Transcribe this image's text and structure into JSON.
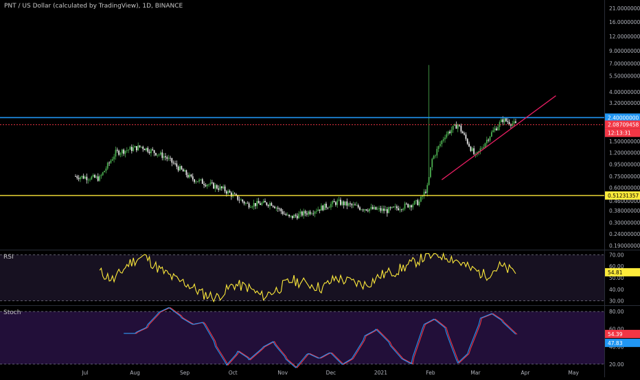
{
  "header": {
    "title": "PNT / US Dollar (calculated by TradingView), 1D, BINANCE"
  },
  "colors": {
    "background": "#000000",
    "up": "#4caf50",
    "down": "#e8e8e8",
    "upper_line": "#2196f3",
    "support_line": "#ffeb3b",
    "last_price_line": "#f23645",
    "trendline": "#e91e63",
    "rsi_line": "#ffeb3b",
    "rsi_band": "#2a1f3d",
    "stoch_k": "#2196f3",
    "stoch_d": "#f23645",
    "stoch_band": "#2b1347",
    "axis_text": "#b2b5be"
  },
  "price_pane": {
    "scale": "log",
    "axis_ticks": [
      "21.00000000",
      "16.00000000",
      "12.00000000",
      "9.00000000",
      "7.00000000",
      "5.50000000",
      "4.00000000",
      "3.20000000",
      "2.40000000",
      "1.50000000",
      "1.20000000",
      "0.95000000",
      "0.75000000",
      "0.60000000",
      "0.46000000",
      "0.38000000",
      "0.30000000",
      "0.24000000",
      "0.19000000"
    ],
    "axis_tick_values": [
      21,
      16,
      12,
      9,
      7,
      5.5,
      4,
      3.2,
      2.4,
      1.5,
      1.2,
      0.95,
      0.75,
      0.6,
      0.46,
      0.38,
      0.3,
      0.24,
      0.19
    ],
    "ylim": [
      0.18,
      24
    ],
    "upper_level": 2.4,
    "upper_label": "2.40000000",
    "support_level": 0.51231357,
    "support_label": "0.51231357",
    "last_price": 2.08709458,
    "last_price_label": "2.08709458",
    "countdown_label": "12:13:31"
  },
  "rsi_pane": {
    "label": "RSI",
    "axis_ticks": [
      "70.00",
      "60.00",
      "50.00",
      "40.00",
      "30.00"
    ],
    "axis_tick_values": [
      70,
      60,
      50,
      40,
      30
    ],
    "ylim": [
      28,
      72
    ],
    "upper_band": 70,
    "lower_band": 30,
    "current_label": "54.81"
  },
  "stoch_pane": {
    "label": "Stoch",
    "axis_ticks": [
      "80.00",
      "60.00",
      "40.00",
      "20.00"
    ],
    "axis_tick_values": [
      80,
      60,
      40,
      20
    ],
    "ylim": [
      16,
      84
    ],
    "upper_band": 80,
    "lower_band": 20,
    "k_label": "54.39",
    "d_label": "47.83"
  },
  "time_axis": {
    "labels": [
      "Jul",
      "Aug",
      "Sep",
      "Oct",
      "Nov",
      "Dec",
      "2021",
      "Feb",
      "Mar",
      "Apr",
      "May"
    ]
  },
  "chart_data": {
    "type": "candlestick",
    "title": "PNT / US Dollar (calculated by TradingView), 1D, BINANCE",
    "y_scale": "log",
    "ylim": [
      0.18,
      24
    ],
    "anchors_x": [
      "Jul",
      "Aug",
      "Sep",
      "Oct",
      "Nov",
      "Dec",
      "2021",
      "Feb",
      "Mar",
      "Apr",
      "May"
    ],
    "price_path_keyframes": [
      {
        "date": "2020-06-25",
        "close": 0.75
      },
      {
        "date": "2020-07-10",
        "close": 0.72
      },
      {
        "date": "2020-07-20",
        "close": 1.2
      },
      {
        "date": "2020-08-05",
        "close": 1.35
      },
      {
        "date": "2020-08-20",
        "close": 1.1
      },
      {
        "date": "2020-09-05",
        "close": 0.72
      },
      {
        "date": "2020-09-25",
        "close": 0.58
      },
      {
        "date": "2020-10-10",
        "close": 0.43
      },
      {
        "date": "2020-10-25",
        "close": 0.44
      },
      {
        "date": "2020-11-05",
        "close": 0.33
      },
      {
        "date": "2020-11-20",
        "close": 0.38
      },
      {
        "date": "2020-12-05",
        "close": 0.45
      },
      {
        "date": "2020-12-20",
        "close": 0.4
      },
      {
        "date": "2021-01-05",
        "close": 0.38
      },
      {
        "date": "2021-01-25",
        "close": 0.45
      },
      {
        "date": "2021-01-30",
        "close": 0.6
      },
      {
        "date": "2021-02-02",
        "close": 1.05
      },
      {
        "date": "2021-02-10",
        "close": 1.7
      },
      {
        "date": "2021-02-18",
        "close": 2.1
      },
      {
        "date": "2021-03-01",
        "close": 1.1
      },
      {
        "date": "2021-03-10",
        "close": 1.7
      },
      {
        "date": "2021-03-18",
        "close": 2.3
      },
      {
        "date": "2021-03-26",
        "close": 2.09
      }
    ],
    "spike_high": 6.8,
    "series": [
      {
        "name": "RSI",
        "values_keyframes": [
          55,
          48,
          62,
          69,
          58,
          50,
          44,
          36,
          33,
          44,
          42,
          34,
          40,
          48,
          45,
          41,
          50,
          46,
          44,
          52,
          56,
          62,
          68,
          70,
          66,
          58,
          52,
          60,
          55
        ]
      },
      {
        "name": "Stoch %K",
        "values_keyframes": [
          55,
          55,
          62,
          78,
          85,
          74,
          65,
          68,
          42,
          18,
          35,
          25,
          38,
          46,
          28,
          15,
          33,
          26,
          34,
          19,
          28,
          52,
          60,
          45,
          28,
          20,
          64,
          72,
          60,
          20,
          34,
          72,
          78,
          68,
          54
        ]
      }
    ]
  }
}
